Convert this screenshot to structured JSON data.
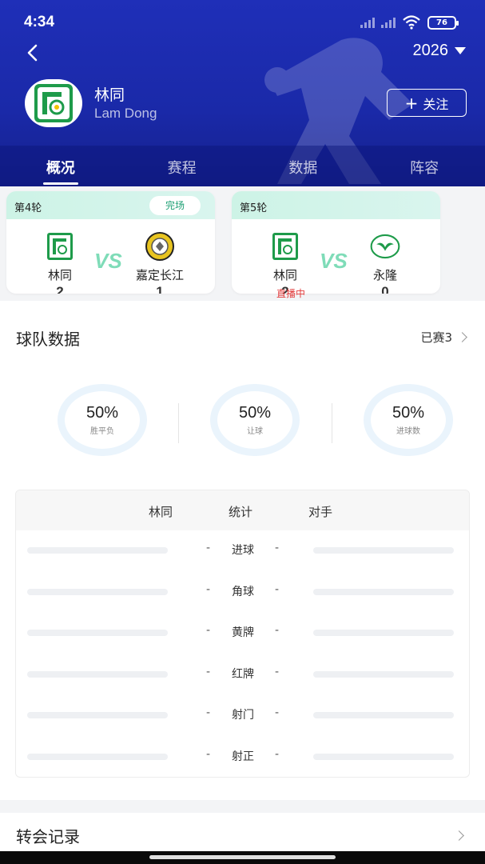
{
  "status_bar": {
    "time": "4:34",
    "battery": "76"
  },
  "header": {
    "season": "2026",
    "team_name": "林同",
    "team_name_en": "Lam Dong",
    "follow_label": "关注"
  },
  "tabs": [
    {
      "label": "概况",
      "active": true
    },
    {
      "label": "赛程",
      "active": false
    },
    {
      "label": "数据",
      "active": false
    },
    {
      "label": "阵容",
      "active": false
    }
  ],
  "matches": [
    {
      "round": "第4轮",
      "status": "完场",
      "home": "林同",
      "away": "嘉定长江",
      "home_score": "2",
      "away_score": "1",
      "vs": "VS"
    },
    {
      "round": "第5轮",
      "status": "",
      "home": "林同",
      "away": "永隆",
      "home_score": "2",
      "away_score": "0",
      "vs": "VS",
      "live": "直播中"
    }
  ],
  "team_stats": {
    "title": "球队数据",
    "played": "已赛3",
    "rings": [
      {
        "value": "50%",
        "label": "胜平负"
      },
      {
        "value": "50%",
        "label": "让球"
      },
      {
        "value": "50%",
        "label": "进球数"
      }
    ],
    "table": {
      "headers": {
        "team": "林同",
        "stat": "统计",
        "opponent": "对手"
      },
      "rows": [
        {
          "label": "进球",
          "team": "-",
          "opponent": "-"
        },
        {
          "label": "角球",
          "team": "-",
          "opponent": "-"
        },
        {
          "label": "黄牌",
          "team": "-",
          "opponent": "-"
        },
        {
          "label": "红牌",
          "team": "-",
          "opponent": "-"
        },
        {
          "label": "射门",
          "team": "-",
          "opponent": "-"
        },
        {
          "label": "射正",
          "team": "-",
          "opponent": "-"
        }
      ]
    }
  },
  "transfers": {
    "title": "转会记录"
  },
  "colors": {
    "header_blue": "#1f2fb8",
    "accent_green": "#1a9e72",
    "vs_green": "#7fdcb8",
    "live_red": "#e23b3b"
  }
}
